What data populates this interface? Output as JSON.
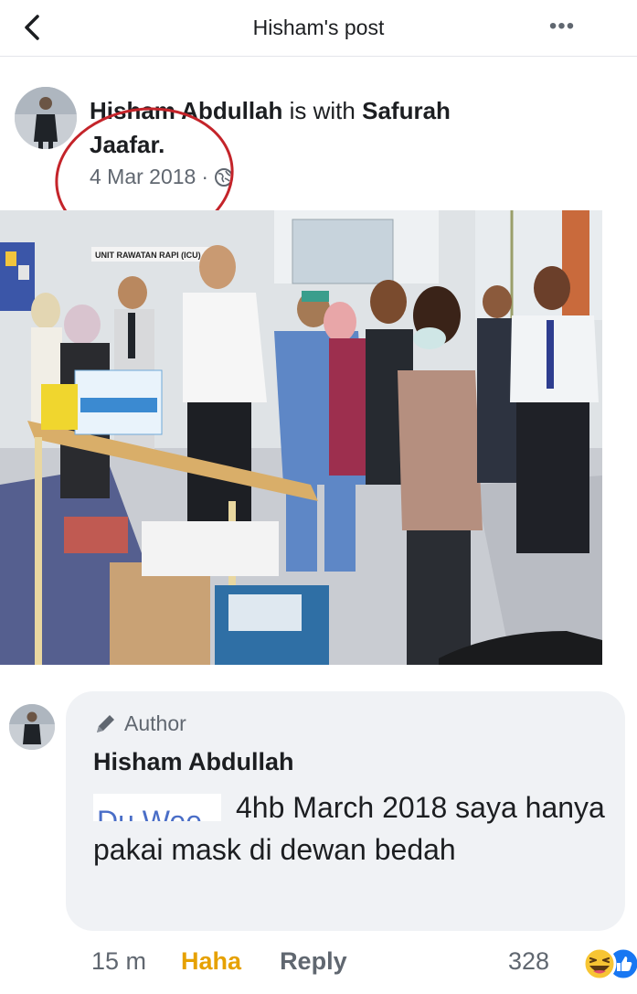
{
  "header": {
    "title": "Hisham's post",
    "more_label": "•••"
  },
  "post": {
    "author": "Hisham Abdullah",
    "with_text": "is with",
    "tagged": "Safurah",
    "tagged_line2": "Jaafar.",
    "date": "4 Mar 2018",
    "separator": "·",
    "privacy_icon": "globe-icon",
    "photo_sign": "UNIT RAWATAN RAPI (ICU)"
  },
  "comment": {
    "badge": "Author",
    "badge_icon": "pencil-icon",
    "author": "Hisham Abdullah",
    "redacted_fragment": "Du Wee",
    "text": "4hb March 2018 saya hanya pakai mask di dewan bedah",
    "time": "15 m",
    "haha_label": "Haha",
    "reply_label": "Reply",
    "reaction_count": "328"
  },
  "colors": {
    "annotation_circle": "#c4242a",
    "haha": "#e6a100",
    "bubble": "#f0f2f5",
    "muted_text": "#606770"
  }
}
